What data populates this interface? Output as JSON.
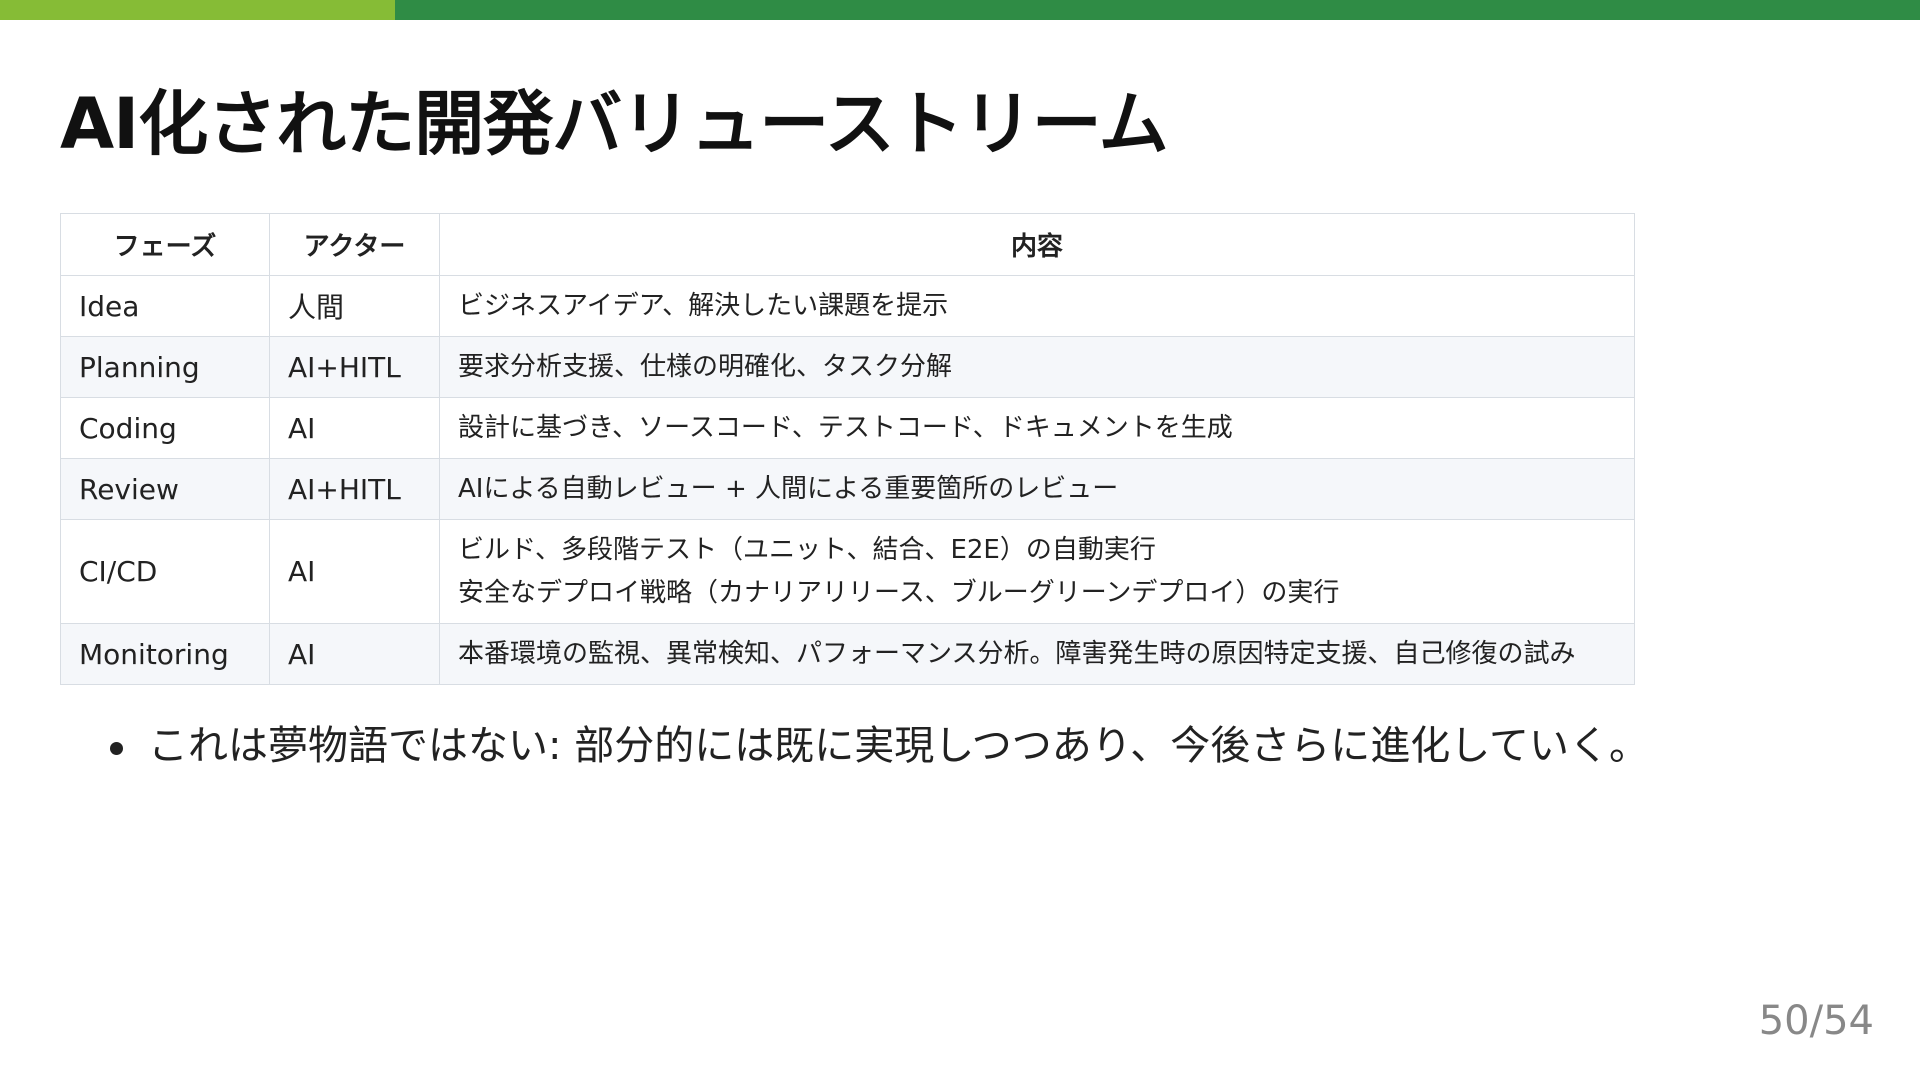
{
  "slide": {
    "title": "AI化された開発バリューストリーム",
    "page_number": "50/54"
  },
  "colors": {
    "topbar_light": "#86bc36",
    "topbar_dark": "#2f8c45"
  },
  "table": {
    "headers": [
      "フェーズ",
      "アクター",
      "内容"
    ],
    "rows": [
      {
        "phase": "Idea",
        "actor": "人間",
        "content": [
          "ビジネスアイデア、解決したい課題を提示"
        ]
      },
      {
        "phase": "Planning",
        "actor": "AI+HITL",
        "content": [
          "要求分析支援、仕様の明確化、タスク分解"
        ]
      },
      {
        "phase": "Coding",
        "actor": "AI",
        "content": [
          "設計に基づき、ソースコード、テストコード、ドキュメントを生成"
        ]
      },
      {
        "phase": "Review",
        "actor": "AI+HITL",
        "content": [
          "AIによる自動レビュー + 人間による重要箇所のレビュー"
        ]
      },
      {
        "phase": "CI/CD",
        "actor": "AI",
        "content": [
          "ビルド、多段階テスト（ユニット、結合、E2E）の自動実行",
          "安全なデプロイ戦略（カナリアリリース、ブルーグリーンデプロイ）の実行"
        ]
      },
      {
        "phase": "Monitoring",
        "actor": "AI",
        "content": [
          "本番環境の監視、異常検知、パフォーマンス分析。障害発生時の原因特定支援、自己修復の試み"
        ]
      }
    ]
  },
  "bullets": [
    "これは夢物語ではない: 部分的には既に実現しつつあり、今後さらに進化していく。"
  ]
}
